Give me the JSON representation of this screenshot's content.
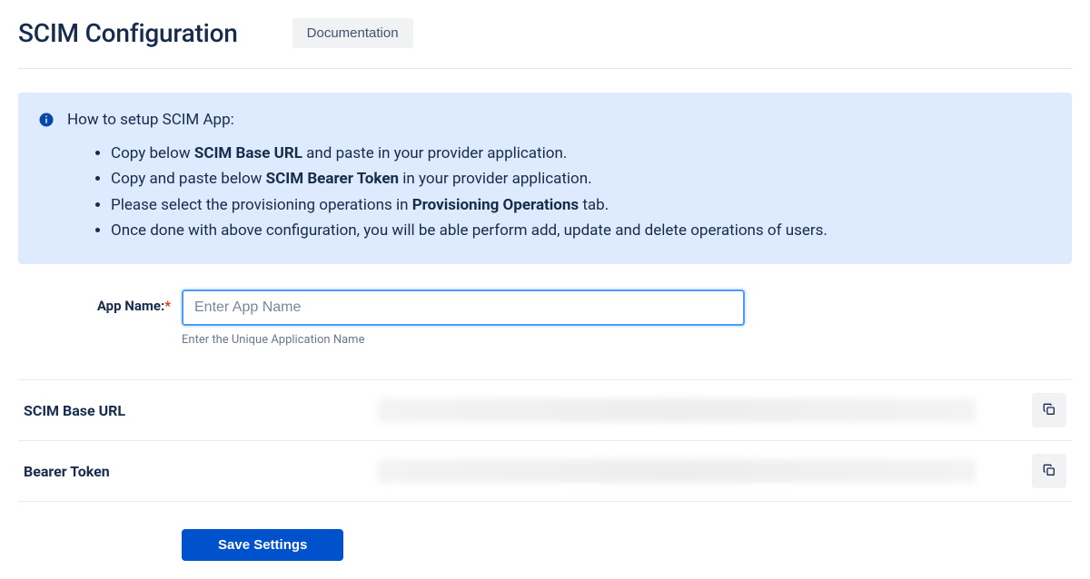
{
  "header": {
    "title": "SCIM Configuration",
    "doc_button": "Documentation"
  },
  "info": {
    "heading": "How to setup SCIM App:",
    "items": [
      {
        "pre": "Copy below ",
        "bold": "SCIM Base URL",
        "post": " and paste in your provider application."
      },
      {
        "pre": "Copy and paste below ",
        "bold": "SCIM Bearer Token",
        "post": " in your provider application."
      },
      {
        "pre": "Please select the provisioning operations in ",
        "bold": "Provisioning Operations",
        "post": " tab."
      },
      {
        "pre": "Once done with above configuration, you will be able perform add, update and delete operations of users.",
        "bold": "",
        "post": ""
      }
    ]
  },
  "form": {
    "app_name_label": "App Name:",
    "app_name_placeholder": "Enter App Name",
    "app_name_value": "",
    "app_name_helper": "Enter the Unique Application Name"
  },
  "rows": {
    "base_url_label": "SCIM Base URL",
    "bearer_label": "Bearer Token"
  },
  "buttons": {
    "save": "Save Settings"
  }
}
